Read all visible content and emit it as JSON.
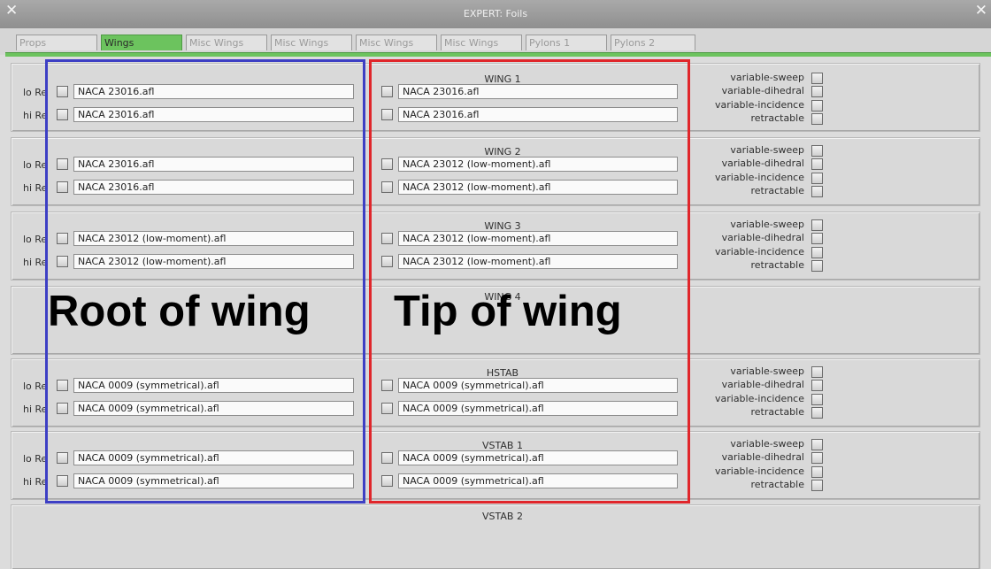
{
  "window": {
    "title": "EXPERT: Foils",
    "close_glyph": "✕"
  },
  "tabs": [
    {
      "label": "Props"
    },
    {
      "label": "Wings"
    },
    {
      "label": "Misc Wings"
    },
    {
      "label": "Misc Wings"
    },
    {
      "label": "Misc Wings"
    },
    {
      "label": "Misc Wings"
    },
    {
      "label": "Pylons 1"
    },
    {
      "label": "Pylons 2"
    }
  ],
  "active_tab": "Wings",
  "row_labels": {
    "lo": "lo Re",
    "hi": "hi Re"
  },
  "options": [
    "variable-sweep",
    "variable-dihedral",
    "variable-incidence",
    "retractable"
  ],
  "groups": [
    {
      "title": "WING 1",
      "lo_root": "NACA 23016.afl",
      "hi_root": "NACA 23016.afl",
      "lo_tip": "NACA 23016.afl",
      "hi_tip": "NACA 23016.afl"
    },
    {
      "title": "WING 2",
      "lo_root": "NACA 23016.afl",
      "hi_root": "NACA 23016.afl",
      "lo_tip": "NACA 23012 (low-moment).afl",
      "hi_tip": "NACA 23012 (low-moment).afl"
    },
    {
      "title": "WING 3",
      "lo_root": "NACA 23012 (low-moment).afl",
      "hi_root": "NACA 23012 (low-moment).afl",
      "lo_tip": "NACA 23012 (low-moment).afl",
      "hi_tip": "NACA 23012 (low-moment).afl"
    },
    {
      "title": "WING 4"
    },
    {
      "title": "HSTAB",
      "lo_root": "NACA 0009 (symmetrical).afl",
      "hi_root": "NACA 0009 (symmetrical).afl",
      "lo_tip": "NACA 0009 (symmetrical).afl",
      "hi_tip": "NACA 0009 (symmetrical).afl"
    },
    {
      "title": "VSTAB 1",
      "lo_root": "NACA 0009 (symmetrical).afl",
      "hi_root": "NACA 0009 (symmetrical).afl",
      "lo_tip": "NACA 0009 (symmetrical).afl",
      "hi_tip": "NACA 0009 (symmetrical).afl"
    },
    {
      "title": "VSTAB 2"
    }
  ],
  "annotations": {
    "root": "Root of wing",
    "tip": "Tip of wing",
    "root_color": "#3d3fc4",
    "tip_color": "#e0262b"
  },
  "colors": {
    "tab_active": "#6cc35e",
    "titlebar": "#9a9a9a"
  }
}
